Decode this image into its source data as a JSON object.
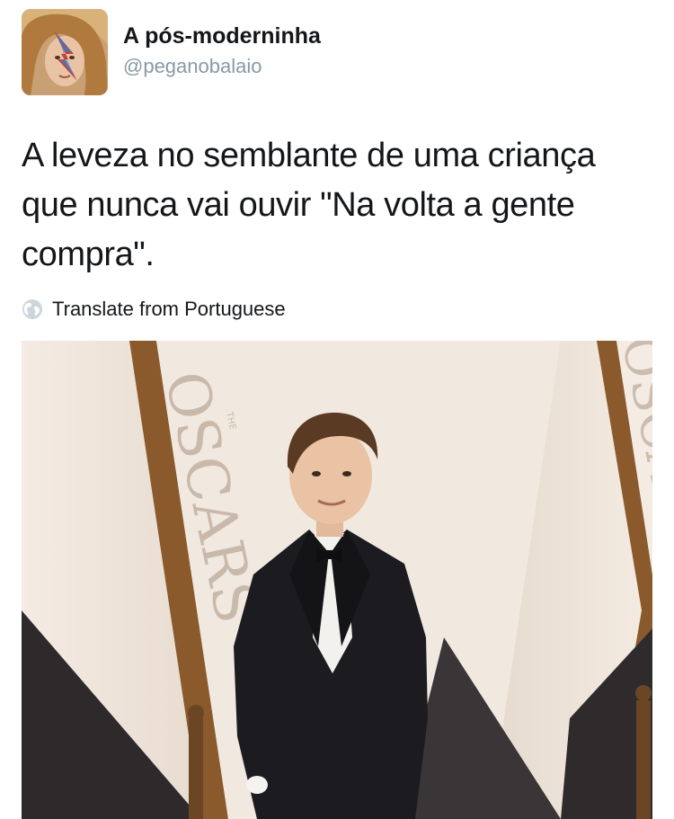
{
  "tweet": {
    "author": {
      "display_name": "A pós-moderninha",
      "handle": "@peganobalaio",
      "avatar_icon": "avatar-photo"
    },
    "text": "A leveza no semblante de uma criança que nunca vai ouvir \"Na volta a gente compra\".",
    "translate": {
      "label": "Translate from Portuguese",
      "icon": "globe-icon"
    },
    "media": {
      "backdrop_text": "OSCARS",
      "backdrop_text_small": "THE",
      "type": "photo"
    }
  },
  "colors": {
    "text": "#14171a",
    "secondary": "#8899a6",
    "backdrop": "#efe6de",
    "gold_stripe": "#8a5a2c"
  }
}
